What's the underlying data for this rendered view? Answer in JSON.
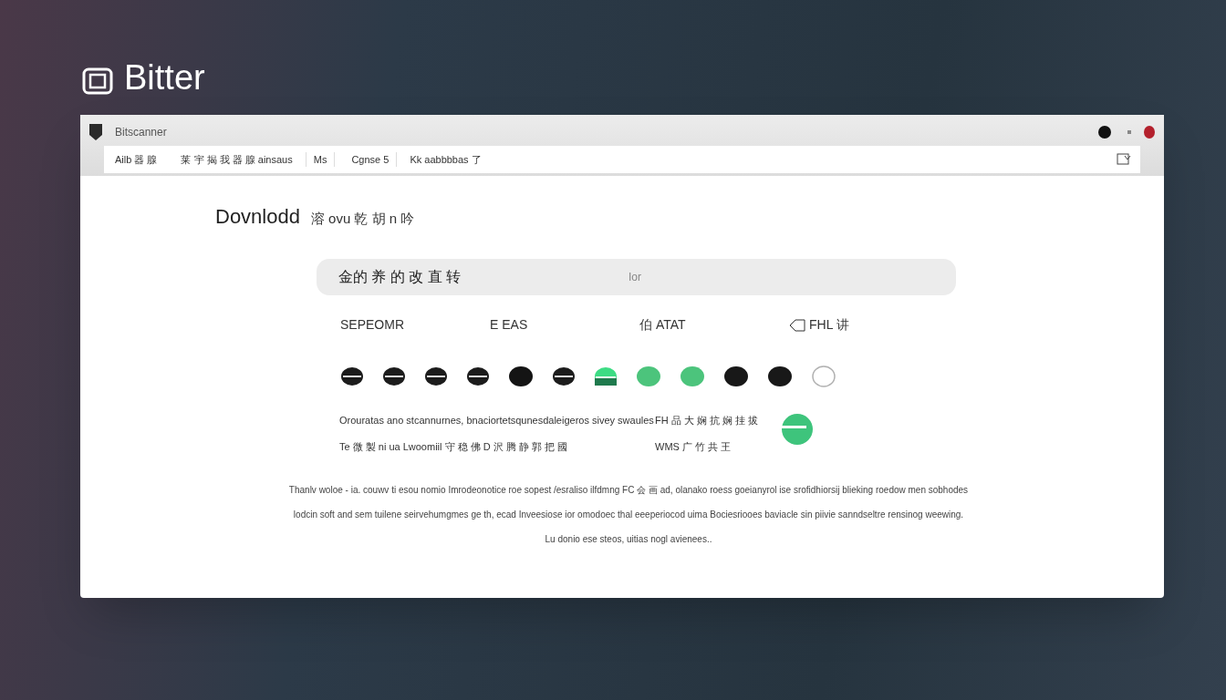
{
  "brand": {
    "name": "Bitter"
  },
  "window": {
    "title": "Bitscanner"
  },
  "toolbar": {
    "segments": [
      "Ailb 器 腺",
      "莱 宇 揭 我 器 腺 ainsaus",
      "Ms",
      "Cgnse 5",
      "Kk aabbbbas 了"
    ]
  },
  "page": {
    "heading": "Dovnlodd",
    "subheading": "溶 ovu 乾 胡 n 吟"
  },
  "search": {
    "value": "金的 养 的 改 直 转",
    "hint": "Ior"
  },
  "options": [
    {
      "label": "SEPEOMR",
      "icon": false
    },
    {
      "label": "E EAS",
      "icon": false
    },
    {
      "label": "伯 ATAT",
      "icon": false
    },
    {
      "label": "FHL 讲",
      "icon": true
    }
  ],
  "dots": [
    {
      "kind": "striped",
      "color": "#1c1c1c"
    },
    {
      "kind": "striped",
      "color": "#1c1c1c"
    },
    {
      "kind": "striped",
      "color": "#1c1c1c"
    },
    {
      "kind": "striped",
      "color": "#1c1c1c"
    },
    {
      "kind": "solid",
      "color": "#141414"
    },
    {
      "kind": "striped",
      "color": "#1c1c1c"
    },
    {
      "kind": "split",
      "color": "#3ddc84"
    },
    {
      "kind": "solid",
      "color": "#4cc47c"
    },
    {
      "kind": "solid",
      "color": "#4cc47c"
    },
    {
      "kind": "solid",
      "color": "#181818"
    },
    {
      "kind": "solid",
      "color": "#181818"
    },
    {
      "kind": "outline",
      "color": "#b0b0b0"
    }
  ],
  "details": {
    "lines": [
      "Orouratas ano stcannurnes, bnaciortetsqunesdaleigeros sivey swaules",
      "Te 微 製 ni ua Lwoomiil 守 稳 佛 D 沢 腾 静 郭 把 國"
    ],
    "side_lines": [
      "FH 品 大 娴 抗 娴 挂 拔",
      "WMS 广 竹 共 王"
    ]
  },
  "description": [
    "Thanlv woloe - ia. couwv ti esou nomio Imrodeonotice roe sopest /esraliso ilfdmng FC 会 画 ad, olanako roess goeianyrol ise srofidhiorsij blieking roedow men sobhodes",
    "lodcin soft and sem tuilene seirvehumgmes ge th, ecad Inveesiose ior omodoec thal eeeperiocod uima Bociesriooes baviacle sin piivie sanndseltre rensinog weewing.",
    "Lu donio ese steos, uitias nogl avienees.."
  ]
}
